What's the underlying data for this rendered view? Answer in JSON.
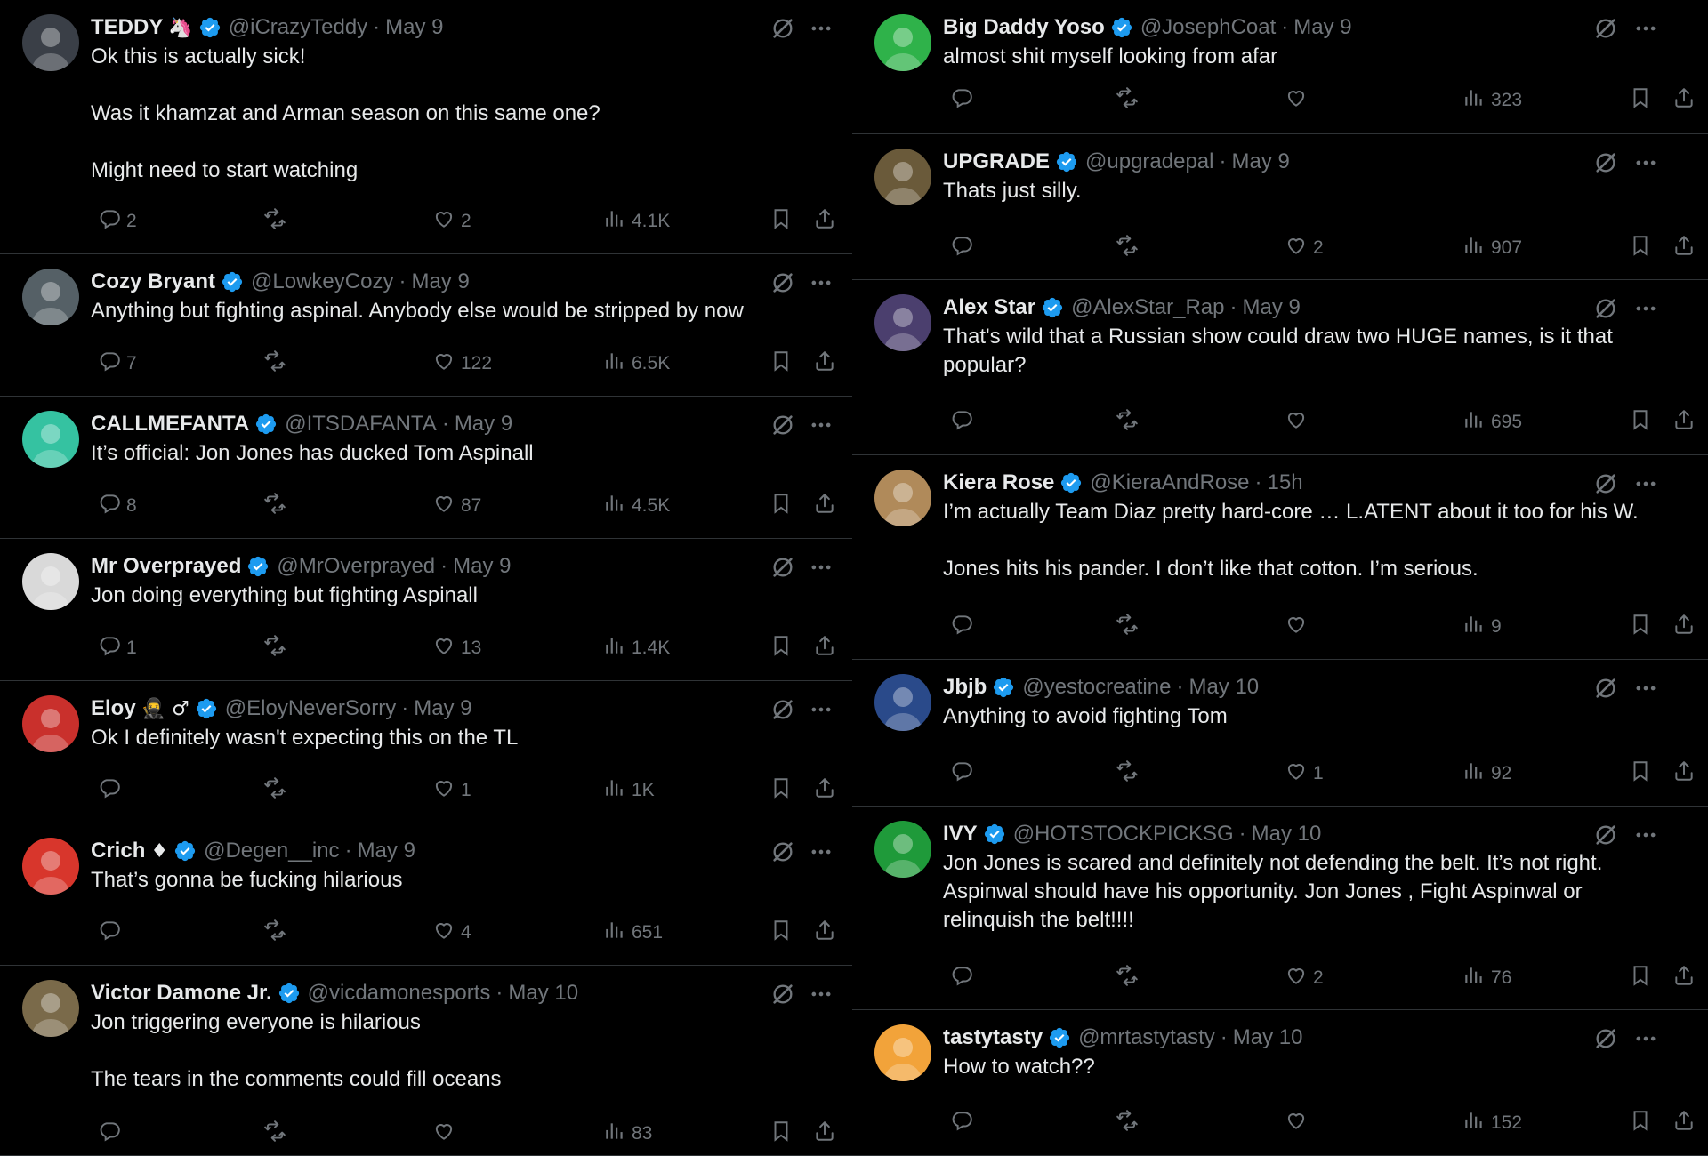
{
  "colors": {
    "background": "#000000",
    "text": "#e7e9ea",
    "muted": "#71767b",
    "verified": "#1d9bf0",
    "border": "#2f3336"
  },
  "left_column": [
    {
      "name": "TEDDY",
      "emoji": "🦄",
      "handle": "@iCrazyTeddy",
      "time": "May 9",
      "text": "Ok this is actually sick!\n\nWas it khamzat and Arman season on this same one?\n\nMight need to start watching",
      "replies": "2",
      "reposts": "",
      "likes": "2",
      "views": "4.1K",
      "avatar_color": "#3a3f47"
    },
    {
      "name": "Cozy Bryant",
      "emoji": "",
      "handle": "@LowkeyCozy",
      "time": "May 9",
      "text": "Anything but fighting aspinal. Anybody else would be stripped by now",
      "replies": "7",
      "reposts": "",
      "likes": "122",
      "views": "6.5K",
      "avatar_color": "#556066"
    },
    {
      "name": "CALLMEFANTA",
      "emoji": "",
      "handle": "@ITSDAFANTA",
      "time": "May 9",
      "text": "It’s official: Jon Jones has ducked Tom Aspinall",
      "replies": "8",
      "reposts": "",
      "likes": "87",
      "views": "4.5K",
      "avatar_color": "#35c2a1"
    },
    {
      "name": "Mr Overprayed",
      "emoji": "",
      "handle": "@MrOverprayed",
      "time": "May 9",
      "text": "Jon doing everything but fighting Aspinall",
      "replies": "1",
      "reposts": "",
      "likes": "13",
      "views": "1.4K",
      "avatar_color": "#d9d9d9"
    },
    {
      "name": "Eloy",
      "emoji": "🥷 ♂",
      "handle": "@EloyNeverSorry",
      "time": "May 9",
      "text": "Ok I definitely wasn't expecting this on the TL",
      "replies": "",
      "reposts": "",
      "likes": "1",
      "views": "1K",
      "avatar_color": "#c9302c"
    },
    {
      "name": "Crich",
      "emoji": "♦",
      "handle": "@Degen__inc",
      "time": "May 9",
      "text": "That’s gonna be fucking hilarious",
      "replies": "",
      "reposts": "",
      "likes": "4",
      "views": "651",
      "avatar_color": "#d8362c"
    },
    {
      "name": "Victor Damone Jr.",
      "emoji": "",
      "handle": "@vicdamonesports",
      "time": "May 10",
      "text": "Jon triggering everyone is hilarious\n\nThe tears in the comments could fill oceans",
      "replies": "",
      "reposts": "",
      "likes": "",
      "views": "83",
      "avatar_color": "#7a6a4a"
    }
  ],
  "right_column": [
    {
      "name": "Big Daddy Yoso",
      "emoji": "",
      "handle": "@JosephCoat",
      "time": "May 9",
      "text": "almost shit myself looking from afar",
      "replies": "",
      "reposts": "",
      "likes": "",
      "views": "323",
      "avatar_color": "#2fb24a"
    },
    {
      "name": "UPGRADE",
      "emoji": "",
      "handle": "@upgradepal",
      "time": "May 9",
      "text": "Thats just silly.",
      "replies": "",
      "reposts": "",
      "likes": "2",
      "views": "907",
      "avatar_color": "#6a5a3a"
    },
    {
      "name": "Alex Star",
      "emoji": "",
      "handle": "@AlexStar_Rap",
      "time": "May 9",
      "text": "That's wild that a Russian show could draw two HUGE names, is it that popular?",
      "replies": "",
      "reposts": "",
      "likes": "",
      "views": "695",
      "avatar_color": "#4b3f6e"
    },
    {
      "name": "Kiera Rose",
      "emoji": "",
      "handle": "@KieraAndRose",
      "time": "15h",
      "text": "I’m actually Team Diaz pretty hard-core … L.ATENT about it too for his W.\n\nJones hits his pander. I don’t like that cotton. I’m serious.",
      "replies": "",
      "reposts": "",
      "likes": "",
      "views": "9",
      "avatar_color": "#b08a5a"
    },
    {
      "name": "Jbjb",
      "emoji": "",
      "handle": "@yestocreatine",
      "time": "May 10",
      "text": "Anything to avoid fighting Tom",
      "replies": "",
      "reposts": "",
      "likes": "1",
      "views": "92",
      "avatar_color": "#2a4a8a"
    },
    {
      "name": "IVY",
      "emoji": "",
      "handle": "@HOTSTOCKPICKSG",
      "time": "May 10",
      "text": "Jon Jones is scared and definitely not defending the belt. It’s not right. Aspinwal should have his opportunity. Jon Jones , Fight Aspinwal or relinquish the belt!!!!",
      "replies": "",
      "reposts": "",
      "likes": "2",
      "views": "76",
      "avatar_color": "#1f9a3a"
    },
    {
      "name": "tastytasty",
      "emoji": "",
      "handle": "@mrtastytasty",
      "time": "May 10",
      "text": "How to watch??",
      "replies": "",
      "reposts": "",
      "likes": "",
      "views": "152",
      "avatar_color": "#f2a33a"
    }
  ]
}
